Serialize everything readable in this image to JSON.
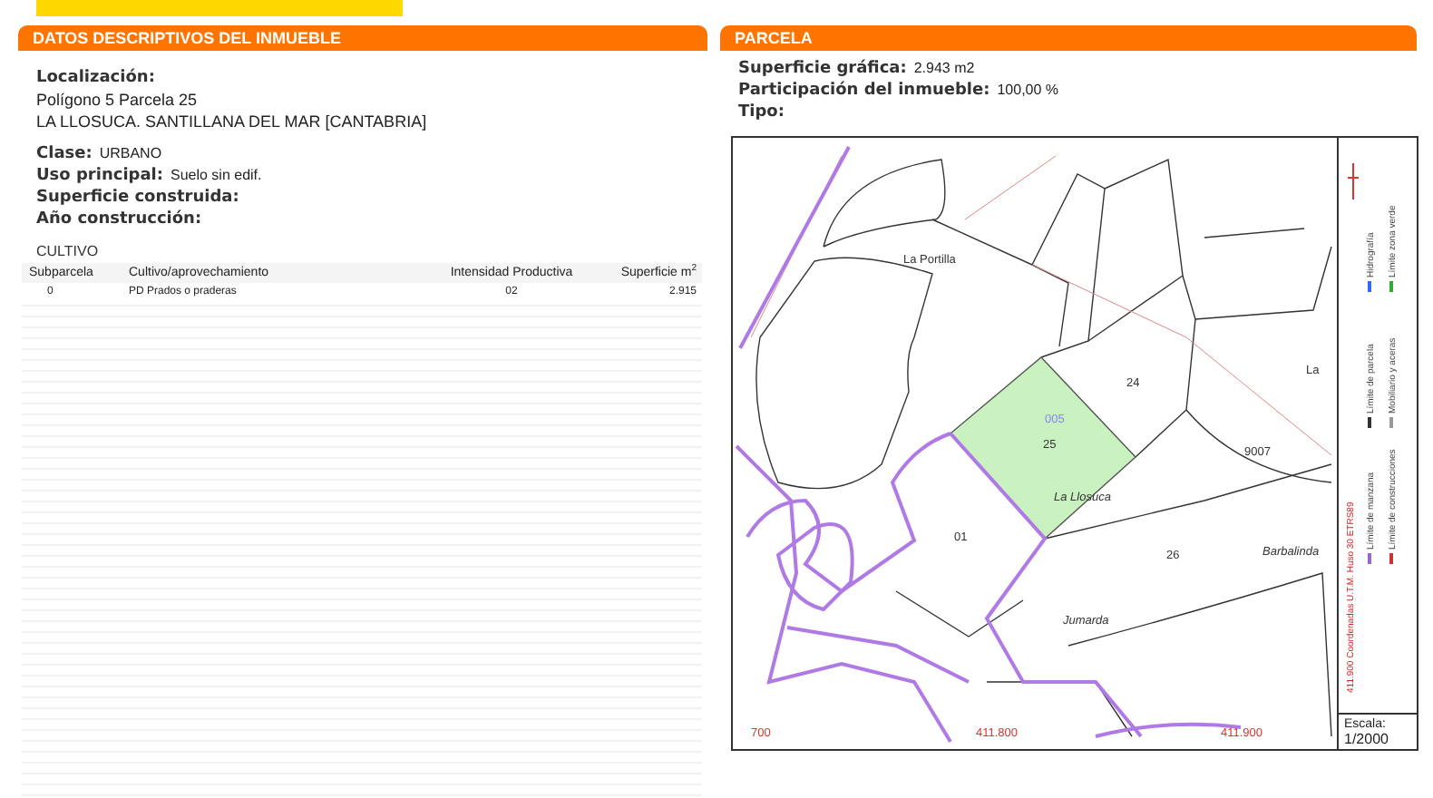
{
  "left_panel": {
    "title": "DATOS DESCRIPTIVOS DEL INMUEBLE",
    "localizacion": {
      "label": "Localización:",
      "lines": [
        "Polígono 5 Parcela 25",
        "LA LLOSUCA. SANTILLANA DEL MAR [CANTABRIA]"
      ]
    },
    "fields": [
      {
        "label": "Clase:",
        "value": "URBANO"
      },
      {
        "label": "Uso principal:",
        "value": "Suelo sin edif."
      },
      {
        "label": "Superficie construida:"
      },
      {
        "label": "Año construcción:"
      }
    ],
    "cultivo": {
      "title": "CULTIVO",
      "columns": [
        "Subparcela",
        "Cultivo/aprovechamiento",
        "Intensidad Productiva",
        "Superficie m$^{2}$"
      ],
      "rows": [
        [
          "0",
          "PD Prados o praderas",
          "02",
          "2.915"
        ]
      ]
    }
  },
  "right_panel": {
    "title": "PARCELA",
    "fields": [
      {
        "label": "Superficie gráfica:",
        "value": "2.943 m2"
      },
      {
        "label": "Participación del inmueble:",
        "value": "100,00 %"
      },
      {
        "label": "Tipo:"
      }
    ],
    "map": {
      "labels": [
        "La Portilla",
        "24",
        "005",
        "25",
        "La Llosuca",
        "01",
        "26",
        "Jumarda",
        "9007",
        "Barbalinda",
        "La",
        "700",
        "411.800",
        "411.900"
      ],
      "coordinates": "411.900 Coordenadas U.T.M. Huso 30 ETRS89",
      "legend": [
        {
          "label": "Límite de manzana",
          "color": "#9966cc"
        },
        {
          "label": "Límite de construcciones",
          "color": "#cc3333"
        },
        {
          "label": "Límite de parcela",
          "color": "#333333"
        },
        {
          "label": "Mobiliario y aceras",
          "color": "#999999"
        },
        {
          "label": "Hidrografía",
          "color": "#3366ff"
        },
        {
          "label": "Límite zona verde",
          "color": "#33aa33"
        }
      ],
      "scale_label": "Escala:",
      "scale": "1/2000"
    }
  }
}
